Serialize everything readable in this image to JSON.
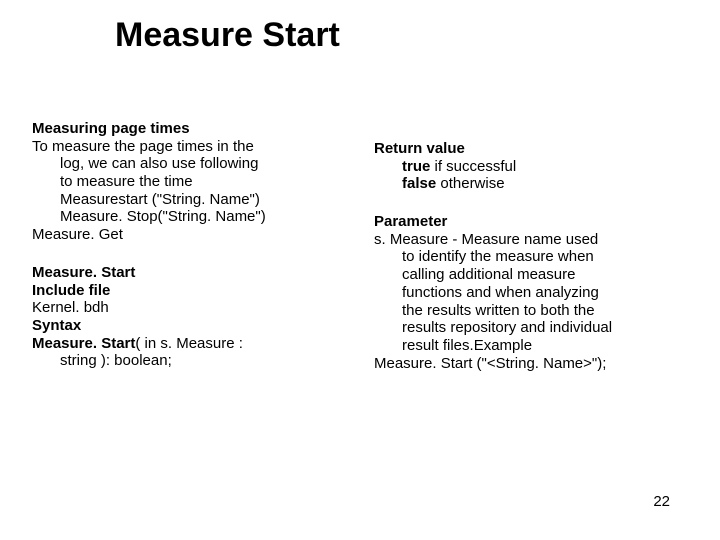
{
  "title": "Measure Start",
  "left": {
    "h1": "Measuring page times",
    "p1a": "To measure the page times in the",
    "p1b": "log, we can also use following",
    "p1c": "to measure the time",
    "p2": "Measurestart (\"String. Name\")",
    "p3": "Measure. Stop(\"String. Name\")",
    "p4": "Measure. Get",
    "h2": "Measure. Start",
    "h3": "Include file",
    "p5": "Kernel. bdh",
    "h4": "Syntax",
    "p6a": "Measure. Start",
    "p6b": "( in s. Measure :",
    "p6c": "string ): boolean;"
  },
  "right": {
    "h1": "Return value",
    "p1a": "true",
    "p1b": " if successful",
    "p2a": "false",
    "p2b": " otherwise",
    "h2": "Parameter",
    "p3a": "s. Measure - Measure name used",
    "p3b": "to identify the measure when",
    "p3c": "calling additional measure",
    "p3d": "functions and when analyzing",
    "p3e": "the results written to both the",
    "p3f": "results repository and individual",
    "p3g": "result files.Example",
    "p4": "Measure. Start (\"<String. Name>\");"
  },
  "pagenum": "22"
}
